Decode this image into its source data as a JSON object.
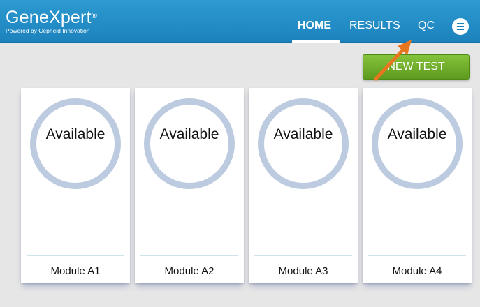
{
  "header": {
    "logo_name": "GeneXpert",
    "logo_mark": "®",
    "logo_tagline": "Powered by Cepheid Innovation",
    "nav": {
      "home": "HOME",
      "results": "RESULTS",
      "qc": "QC"
    },
    "menu_icon": "menu-icon"
  },
  "actions": {
    "new_test_label": "NEW TEST"
  },
  "modules": [
    {
      "status": "Available",
      "name": "Module A1"
    },
    {
      "status": "Available",
      "name": "Module A2"
    },
    {
      "status": "Available",
      "name": "Module A3"
    },
    {
      "status": "Available",
      "name": "Module A4"
    }
  ],
  "colors": {
    "header": "#1c82bd",
    "new_test": "#6aab28",
    "ring": "#bccbe0",
    "annotation_arrow": "#e8761f"
  }
}
